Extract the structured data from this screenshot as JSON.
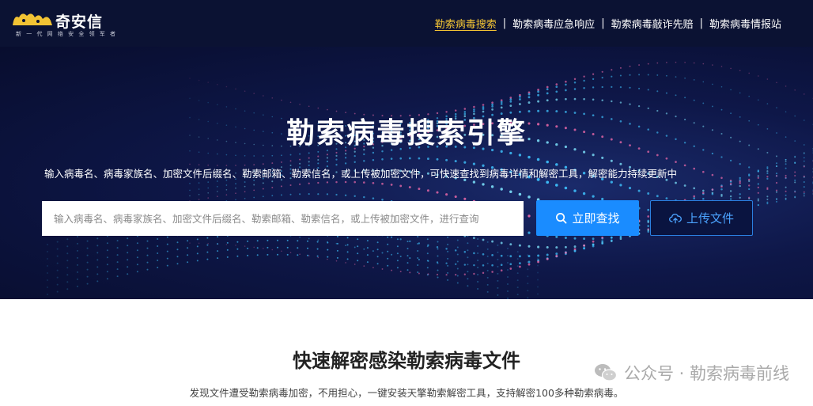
{
  "logo": {
    "name": "奇安信",
    "tagline": "新 一 代 网 络 安 全 领 军 者"
  },
  "nav": {
    "items": [
      {
        "label": "勒索病毒搜索",
        "active": true
      },
      {
        "label": "勒索病毒应急响应",
        "active": false
      },
      {
        "label": "勒索病毒敲诈先赔",
        "active": false
      },
      {
        "label": "勒索病毒情报站",
        "active": false
      }
    ],
    "separator": "|"
  },
  "hero": {
    "title": "勒索病毒搜索引擎",
    "description": "输入病毒名、病毒家族名、加密文件后缀名、勒索邮箱、勒索信名，或上传被加密文件，可快速查找到病毒详情和解密工具，解密能力持续更新中",
    "search_placeholder": "输入病毒名、病毒家族名、加密文件后缀名、勒索邮箱、勒索信名，或上传被加密文件，进行查询",
    "search_button": "立即查找",
    "upload_button": "上传文件"
  },
  "section": {
    "title": "快速解密感染勒索病毒文件",
    "description": "发现文件遭受勒索病毒加密，不用担心，一键安装天擎勒索解密工具，支持解密100多种勒索病毒。"
  },
  "watermark": {
    "text": "公众号 · 勒索病毒前线"
  },
  "colors": {
    "topbar": "#0b1233",
    "accent_yellow": "#f2c334",
    "primary_blue": "#1a8cff"
  }
}
